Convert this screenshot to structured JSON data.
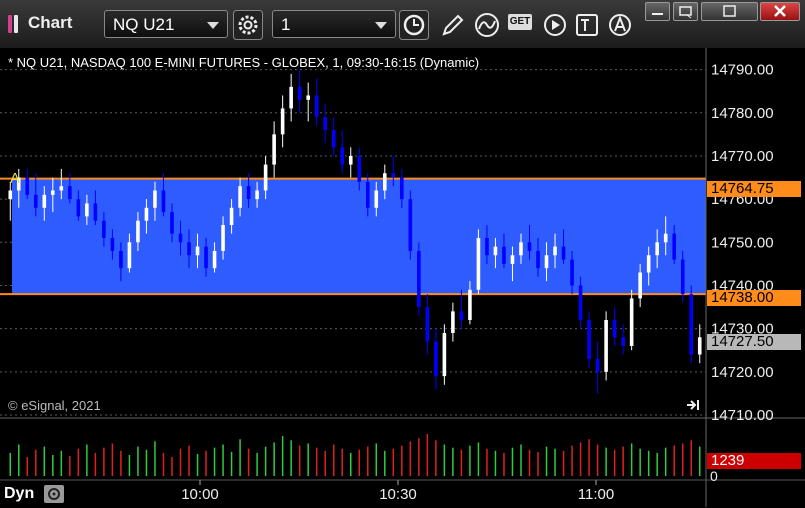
{
  "window": {
    "title": "Chart"
  },
  "toolbar": {
    "symbol": "NQ U21",
    "interval": "1",
    "icons": [
      "gear-icon",
      "clock-icon",
      "pencil-icon",
      "curve-icon",
      "get-icon",
      "play-icon",
      "text-icon",
      "alert-icon"
    ],
    "get_label": "GET"
  },
  "chart": {
    "header": "* NQ U21, NASDAQ 100 E-MINI FUTURES - GLOBEX, 1, 09:30-16:15 (Dynamic)",
    "copyright": "© eSignal, 2021",
    "alert_marker": "A",
    "upper_band_label": "14764.75",
    "lower_band_label": "14738.00",
    "last_price_label": "14727.50",
    "volume_label": "1239",
    "volume_zero": "0",
    "y_ticks": [
      "14790.00",
      "14780.00",
      "14770.00",
      "14760.00",
      "14750.00",
      "14740.00",
      "14730.00",
      "14720.00",
      "14710.00"
    ],
    "x_ticks": [
      "10:00",
      "10:30",
      "11:00"
    ],
    "pane_mode": "Dyn",
    "colors": {
      "band": "#2f5cff",
      "band_line": "#ff8c1a",
      "up": "#ffffff",
      "down": "#0000ff",
      "vol_up": "#2ecc40",
      "vol_down": "#e02020",
      "last_price_bg": "#b8b8b8",
      "volume_bg": "#cc0000"
    }
  },
  "chart_data": {
    "type": "candlestick",
    "ylim": [
      14710,
      14795
    ],
    "y_ticks": [
      14710,
      14720,
      14730,
      14740,
      14750,
      14760,
      14770,
      14780,
      14790
    ],
    "x_tick_labels": [
      "10:00",
      "10:30",
      "11:00"
    ],
    "band": [
      14738.0,
      14764.75
    ],
    "last": 14727.5,
    "volume_last": 1239,
    "candles": [
      [
        14760,
        14764,
        14755,
        14762
      ],
      [
        14762,
        14767,
        14758,
        14765
      ],
      [
        14765,
        14767,
        14760,
        14761
      ],
      [
        14761,
        14766,
        14756,
        14758
      ],
      [
        14758,
        14763,
        14755,
        14761
      ],
      [
        14761,
        14765,
        14757,
        14762
      ],
      [
        14762,
        14767,
        14760,
        14763
      ],
      [
        14763,
        14766,
        14759,
        14760
      ],
      [
        14760,
        14762,
        14755,
        14756
      ],
      [
        14756,
        14761,
        14754,
        14759
      ],
      [
        14759,
        14762,
        14754,
        14755
      ],
      [
        14755,
        14757,
        14749,
        14751
      ],
      [
        14751,
        14753,
        14746,
        14748
      ],
      [
        14748,
        14750,
        14741,
        14744
      ],
      [
        14744,
        14752,
        14743,
        14750
      ],
      [
        14750,
        14757,
        14748,
        14755
      ],
      [
        14755,
        14760,
        14752,
        14758
      ],
      [
        14758,
        14764,
        14755,
        14762
      ],
      [
        14762,
        14766,
        14756,
        14757
      ],
      [
        14757,
        14759,
        14750,
        14752
      ],
      [
        14752,
        14755,
        14747,
        14750
      ],
      [
        14750,
        14753,
        14744,
        14747
      ],
      [
        14747,
        14752,
        14744,
        14749
      ],
      [
        14749,
        14751,
        14742,
        14744
      ],
      [
        14744,
        14750,
        14743,
        14748
      ],
      [
        14748,
        14756,
        14746,
        14754
      ],
      [
        14754,
        14760,
        14752,
        14758
      ],
      [
        14758,
        14765,
        14756,
        14763
      ],
      [
        14763,
        14766,
        14758,
        14760
      ],
      [
        14760,
        14764,
        14758,
        14762
      ],
      [
        14762,
        14770,
        14760,
        14768
      ],
      [
        14768,
        14778,
        14765,
        14775
      ],
      [
        14775,
        14784,
        14772,
        14781
      ],
      [
        14781,
        14789,
        14778,
        14786
      ],
      [
        14786,
        14790,
        14780,
        14783
      ],
      [
        14783,
        14787,
        14778,
        14784
      ],
      [
        14784,
        14788,
        14777,
        14779
      ],
      [
        14779,
        14782,
        14773,
        14776
      ],
      [
        14776,
        14779,
        14770,
        14772
      ],
      [
        14772,
        14776,
        14766,
        14768
      ],
      [
        14768,
        14772,
        14765,
        14770
      ],
      [
        14770,
        14772,
        14762,
        14764
      ],
      [
        14764,
        14766,
        14756,
        14758
      ],
      [
        14758,
        14764,
        14756,
        14762
      ],
      [
        14762,
        14768,
        14760,
        14766
      ],
      [
        14766,
        14770,
        14763,
        14765
      ],
      [
        14765,
        14767,
        14758,
        14760
      ],
      [
        14760,
        14762,
        14746,
        14748
      ],
      [
        14748,
        14750,
        14733,
        14735
      ],
      [
        14735,
        14738,
        14724,
        14727
      ],
      [
        14727,
        14730,
        14716,
        14719
      ],
      [
        14719,
        14731,
        14717,
        14729
      ],
      [
        14729,
        14736,
        14727,
        14734
      ],
      [
        14734,
        14739,
        14730,
        14732
      ],
      [
        14732,
        14741,
        14731,
        14739
      ],
      [
        14739,
        14753,
        14738,
        14751
      ],
      [
        14751,
        14754,
        14745,
        14747
      ],
      [
        14747,
        14751,
        14744,
        14749
      ],
      [
        14749,
        14752,
        14744,
        14745
      ],
      [
        14745,
        14749,
        14741,
        14747
      ],
      [
        14747,
        14752,
        14745,
        14750
      ],
      [
        14750,
        14754,
        14746,
        14748
      ],
      [
        14748,
        14751,
        14742,
        14744
      ],
      [
        14744,
        14750,
        14741,
        14747
      ],
      [
        14747,
        14752,
        14744,
        14749
      ],
      [
        14749,
        14753,
        14745,
        14746
      ],
      [
        14746,
        14748,
        14738,
        14740
      ],
      [
        14740,
        14742,
        14730,
        14732
      ],
      [
        14732,
        14734,
        14721,
        14723
      ],
      [
        14723,
        14727,
        14715,
        14720
      ],
      [
        14720,
        14734,
        14718,
        14732
      ],
      [
        14732,
        14735,
        14726,
        14728
      ],
      [
        14728,
        14731,
        14724,
        14726
      ],
      [
        14726,
        14739,
        14725,
        14737
      ],
      [
        14737,
        14745,
        14735,
        14743
      ],
      [
        14743,
        14749,
        14740,
        14747
      ],
      [
        14747,
        14753,
        14744,
        14750
      ],
      [
        14750,
        14756,
        14747,
        14752
      ],
      [
        14752,
        14754,
        14745,
        14746
      ],
      [
        14746,
        14748,
        14736,
        14738
      ],
      [
        14738,
        14740,
        14722,
        14724
      ],
      [
        14724,
        14731,
        14722,
        14728
      ]
    ],
    "volume": [
      22,
      30,
      18,
      25,
      28,
      20,
      24,
      19,
      26,
      30,
      22,
      27,
      31,
      24,
      20,
      28,
      25,
      33,
      22,
      18,
      26,
      29,
      21,
      24,
      27,
      30,
      23,
      35,
      26,
      22,
      28,
      32,
      38,
      34,
      29,
      31,
      27,
      24,
      30,
      26,
      22,
      25,
      28,
      31,
      24,
      26,
      29,
      33,
      36,
      40,
      34,
      30,
      27,
      25,
      29,
      32,
      26,
      24,
      22,
      27,
      30,
      25,
      23,
      28,
      26,
      24,
      29,
      32,
      35,
      30,
      27,
      25,
      28,
      31,
      26,
      24,
      22,
      27,
      29,
      31,
      34,
      28
    ]
  }
}
